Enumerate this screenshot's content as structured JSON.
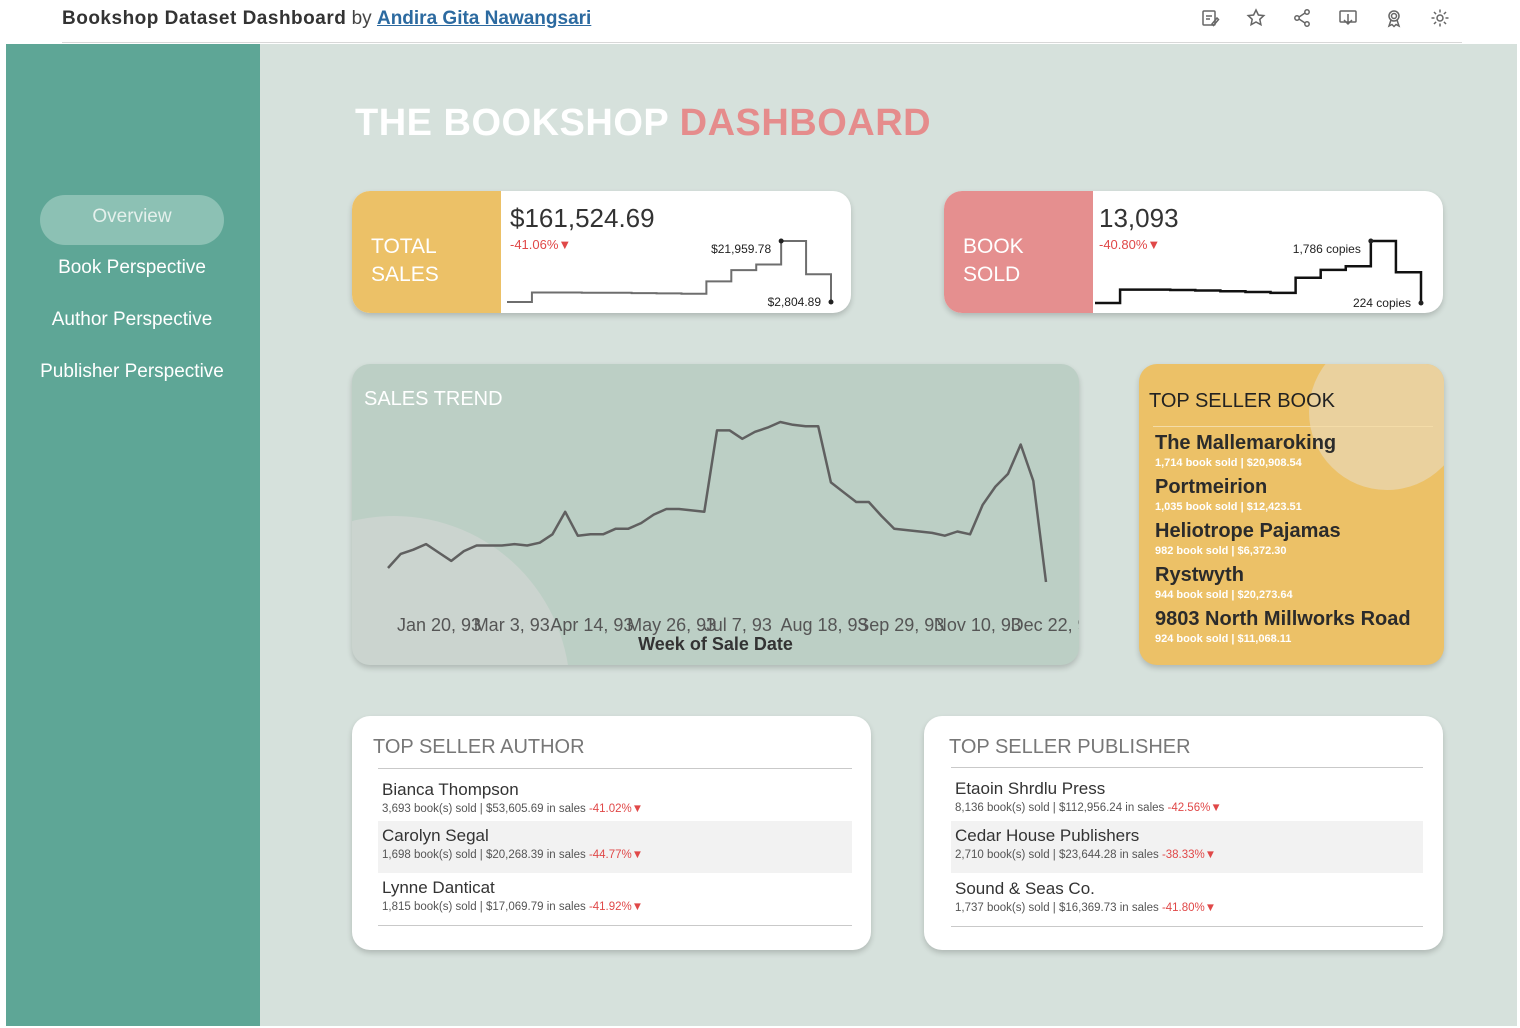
{
  "header": {
    "dashboard_title": "Bookshop Dataset Dashboard",
    "by": "by",
    "author": "Andira Gita Nawangsari",
    "icons": [
      "edit-icon",
      "star-icon",
      "share-icon",
      "download-icon",
      "award-icon",
      "gear-icon"
    ]
  },
  "nav": {
    "items": [
      {
        "label": "Overview",
        "active": true
      },
      {
        "label": "Book Perspective",
        "active": false
      },
      {
        "label": "Author Perspective",
        "active": false
      },
      {
        "label": "Publisher Perspective",
        "active": false
      }
    ]
  },
  "headline": {
    "part1": "THE BOOKSHOP",
    "part2": "DASHBOARD"
  },
  "colors": {
    "sidebar": "#5ea696",
    "accent_yellow": "#ecc167",
    "accent_pink": "#e58c8c",
    "negative": "#e04848",
    "background": "#d6e1dc"
  },
  "kpi_sales": {
    "label_line1": "TOTAL",
    "label_line2": "SALES",
    "value": "$161,524.69",
    "change": "-41.06%▼",
    "peak_label": "$21,959.78",
    "last_label": "$2,804.89",
    "steps": [
      2804.89,
      5800,
      5800,
      5700,
      5700,
      5600,
      5500,
      5400,
      9300,
      12800,
      14600,
      21959.78,
      11500,
      2804.89
    ]
  },
  "kpi_books": {
    "label_line1": "BOOK",
    "label_line2": "SOLD",
    "value": "13,093",
    "change": "-40.80%▼",
    "peak_label": "1,786 copies",
    "last_label": "224 copies",
    "steps": [
      224,
      560,
      560,
      550,
      540,
      520,
      500,
      480,
      860,
      1060,
      1150,
      1786,
      1000,
      224
    ]
  },
  "trend": {
    "title": "SALES TREND",
    "x_title": "Week of Sale Date",
    "x_ticks": [
      "Jan 20, 93",
      "Mar 3, 93",
      "Apr 14, 93",
      "May 26, 93",
      "Jul 7, 93",
      "Aug 18, 93",
      "Sep 29, 93",
      "Nov 10, 93",
      "Dec 22, 9"
    ]
  },
  "chart_data": {
    "type": "line",
    "title": "SALES TREND",
    "xlabel": "Week of Sale Date",
    "ylabel": "",
    "x_tick_labels": [
      "Jan 20, 93",
      "Mar 3, 93",
      "Apr 14, 93",
      "May 26, 93",
      "Jul 7, 93",
      "Aug 18, 93",
      "Sep 29, 93",
      "Nov 10, 93",
      "Dec 22, 9"
    ],
    "series": [
      {
        "name": "",
        "values": [
          10,
          20,
          23,
          27,
          21,
          15,
          22,
          26,
          26,
          26,
          27,
          26,
          28,
          34,
          50,
          33,
          34,
          34,
          38,
          38,
          42,
          48,
          52,
          52,
          51,
          50,
          108,
          108,
          102,
          107,
          110,
          114,
          112,
          111,
          111,
          71,
          64,
          57,
          57,
          47,
          38,
          37,
          36,
          35,
          33,
          36,
          34,
          55,
          68,
          77,
          98,
          72,
          0
        ]
      }
    ],
    "grid": false,
    "legend": "none"
  },
  "top_book": {
    "title": "TOP SELLER BOOK",
    "items": [
      {
        "name": "The Mallemaroking",
        "detail": "1,714 book sold | $20,908.54"
      },
      {
        "name": "Portmeirion",
        "detail": "1,035 book sold | $12,423.51"
      },
      {
        "name": "Heliotrope Pajamas",
        "detail": "982 book sold | $6,372.30"
      },
      {
        "name": "Rystwyth",
        "detail": "944 book sold | $20,273.64"
      },
      {
        "name": "9803 North Millworks Road",
        "detail": "924 book sold | $11,068.11"
      }
    ]
  },
  "top_author": {
    "title": "TOP SELLER AUTHOR",
    "items": [
      {
        "name": "Bianca Thompson",
        "detail": "3,693 book(s) sold | $53,605.69 in sales",
        "change": "-41.02%▼"
      },
      {
        "name": "Carolyn Segal",
        "detail": "1,698 book(s) sold | $20,268.39 in sales",
        "change": "-44.77%▼"
      },
      {
        "name": "Lynne Danticat",
        "detail": "1,815 book(s) sold | $17,069.79 in sales",
        "change": "-41.92%▼"
      }
    ]
  },
  "top_publisher": {
    "title": "TOP SELLER PUBLISHER",
    "items": [
      {
        "name": "Etaoin Shrdlu Press",
        "detail": "8,136 book(s) sold | $112,956.24 in sales",
        "change": "-42.56%▼"
      },
      {
        "name": "Cedar House Publishers",
        "detail": "2,710 book(s) sold | $23,644.28 in sales",
        "change": "-38.33%▼"
      },
      {
        "name": "Sound & Seas Co.",
        "detail": "1,737 book(s) sold | $16,369.73 in sales",
        "change": "-41.80%▼"
      }
    ]
  }
}
